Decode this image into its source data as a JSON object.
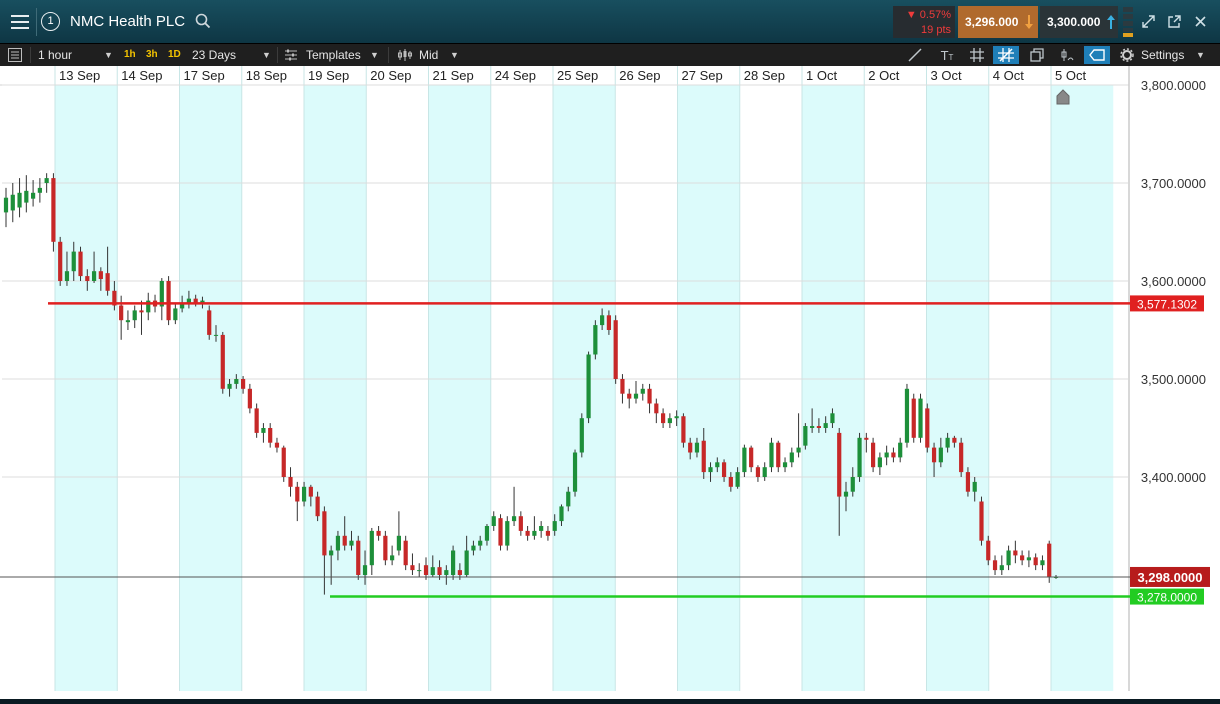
{
  "header": {
    "title": "NMC Health PLC",
    "badge": "1",
    "change_pct": "▼ 0.57%",
    "change_pts": "19 pts",
    "sell_price": "3,296.000",
    "buy_price": "3,300.000"
  },
  "toolbar": {
    "interval": "1 hour",
    "quick_1h": "1h",
    "quick_3h": "3h",
    "quick_1d": "1D",
    "range": "23 Days",
    "templates": "Templates",
    "price_mode": "Mid",
    "settings": "Settings"
  },
  "colors": {
    "up": "#1d8f3a",
    "down": "#c62828",
    "resistance": "#e02020",
    "support": "#22cc22",
    "day_band": "#dcfbfb"
  },
  "chart_data": {
    "type": "candlestick",
    "title": "NMC Health PLC",
    "x_labels": [
      "13 Sep",
      "14 Sep",
      "17 Sep",
      "18 Sep",
      "19 Sep",
      "20 Sep",
      "21 Sep",
      "24 Sep",
      "25 Sep",
      "26 Sep",
      "27 Sep",
      "28 Sep",
      "1 Oct",
      "2 Oct",
      "3 Oct",
      "4 Oct",
      "5 Oct"
    ],
    "y_ticks": [
      "3,800.0000",
      "3,700.0000",
      "3,600.0000",
      "3,500.0000",
      "3,400.0000"
    ],
    "ylim": [
      3190,
      3830
    ],
    "grid": true,
    "current_price": 3298,
    "current_price_label": "3,298.0000",
    "lines": [
      {
        "name": "resistance",
        "value": 3577.1302,
        "label": "3,577.1302",
        "start_label": "13 Sep"
      },
      {
        "name": "support",
        "value": 3278,
        "label": "3,278.0000",
        "start_label": "20 Sep"
      }
    ],
    "candles": [
      {
        "o": 3670,
        "c": 3685,
        "h": 3695,
        "l": 3655
      },
      {
        "o": 3672,
        "c": 3688,
        "h": 3700,
        "l": 3660
      },
      {
        "o": 3675,
        "c": 3690,
        "h": 3705,
        "l": 3665
      },
      {
        "o": 3680,
        "c": 3692,
        "h": 3708,
        "l": 3670
      },
      {
        "o": 3684,
        "c": 3690,
        "h": 3703,
        "l": 3676
      },
      {
        "o": 3690,
        "c": 3695,
        "h": 3705,
        "l": 3680
      },
      {
        "o": 3700,
        "c": 3705,
        "h": 3710,
        "l": 3690
      },
      {
        "o": 3705,
        "c": 3640,
        "h": 3710,
        "l": 3630
      },
      {
        "o": 3640,
        "c": 3600,
        "h": 3645,
        "l": 3595
      },
      {
        "o": 3600,
        "c": 3610,
        "h": 3630,
        "l": 3595
      },
      {
        "o": 3610,
        "c": 3630,
        "h": 3640,
        "l": 3600
      },
      {
        "o": 3630,
        "c": 3605,
        "h": 3635,
        "l": 3600
      },
      {
        "o": 3605,
        "c": 3600,
        "h": 3612,
        "l": 3590
      },
      {
        "o": 3600,
        "c": 3610,
        "h": 3630,
        "l": 3598
      },
      {
        "o": 3610,
        "c": 3602,
        "h": 3614,
        "l": 3590
      },
      {
        "o": 3608,
        "c": 3590,
        "h": 3635,
        "l": 3585
      },
      {
        "o": 3590,
        "c": 3575,
        "h": 3600,
        "l": 3570
      },
      {
        "o": 3575,
        "c": 3560,
        "h": 3585,
        "l": 3540
      },
      {
        "o": 3558,
        "c": 3560,
        "h": 3570,
        "l": 3550
      },
      {
        "o": 3560,
        "c": 3570,
        "h": 3575,
        "l": 3552
      },
      {
        "o": 3570,
        "c": 3568,
        "h": 3580,
        "l": 3545
      },
      {
        "o": 3568,
        "c": 3580,
        "h": 3588,
        "l": 3560
      },
      {
        "o": 3580,
        "c": 3574,
        "h": 3586,
        "l": 3568
      },
      {
        "o": 3574,
        "c": 3600,
        "h": 3603,
        "l": 3560
      },
      {
        "o": 3600,
        "c": 3560,
        "h": 3605,
        "l": 3555
      },
      {
        "o": 3560,
        "c": 3572,
        "h": 3578,
        "l": 3556
      },
      {
        "o": 3572,
        "c": 3578,
        "h": 3585,
        "l": 3568
      },
      {
        "o": 3578,
        "c": 3582,
        "h": 3590,
        "l": 3572
      },
      {
        "o": 3582,
        "c": 3578,
        "h": 3586,
        "l": 3574
      },
      {
        "o": 3578,
        "c": 3580,
        "h": 3584,
        "l": 3572
      },
      {
        "o": 3570,
        "c": 3545,
        "h": 3575,
        "l": 3540
      },
      {
        "o": 3545,
        "c": 3545,
        "h": 3555,
        "l": 3538
      },
      {
        "o": 3545,
        "c": 3490,
        "h": 3548,
        "l": 3485
      },
      {
        "o": 3490,
        "c": 3495,
        "h": 3500,
        "l": 3482
      },
      {
        "o": 3495,
        "c": 3500,
        "h": 3505,
        "l": 3490
      },
      {
        "o": 3500,
        "c": 3490,
        "h": 3503,
        "l": 3485
      },
      {
        "o": 3490,
        "c": 3470,
        "h": 3495,
        "l": 3465
      },
      {
        "o": 3470,
        "c": 3445,
        "h": 3475,
        "l": 3440
      },
      {
        "o": 3445,
        "c": 3450,
        "h": 3455,
        "l": 3435
      },
      {
        "o": 3450,
        "c": 3435,
        "h": 3455,
        "l": 3430
      },
      {
        "o": 3435,
        "c": 3430,
        "h": 3440,
        "l": 3425
      },
      {
        "o": 3430,
        "c": 3400,
        "h": 3432,
        "l": 3395
      },
      {
        "o": 3400,
        "c": 3390,
        "h": 3410,
        "l": 3380
      },
      {
        "o": 3390,
        "c": 3375,
        "h": 3395,
        "l": 3355
      },
      {
        "o": 3375,
        "c": 3390,
        "h": 3395,
        "l": 3370
      },
      {
        "o": 3390,
        "c": 3380,
        "h": 3392,
        "l": 3370
      },
      {
        "o": 3380,
        "c": 3360,
        "h": 3385,
        "l": 3355
      },
      {
        "o": 3365,
        "c": 3320,
        "h": 3370,
        "l": 3280
      },
      {
        "o": 3320,
        "c": 3325,
        "h": 3330,
        "l": 3290
      },
      {
        "o": 3325,
        "c": 3340,
        "h": 3345,
        "l": 3315
      },
      {
        "o": 3340,
        "c": 3330,
        "h": 3360,
        "l": 3325
      },
      {
        "o": 3330,
        "c": 3335,
        "h": 3345,
        "l": 3325
      },
      {
        "o": 3335,
        "c": 3300,
        "h": 3340,
        "l": 3295
      },
      {
        "o": 3300,
        "c": 3310,
        "h": 3325,
        "l": 3290
      },
      {
        "o": 3310,
        "c": 3345,
        "h": 3348,
        "l": 3300
      },
      {
        "o": 3345,
        "c": 3340,
        "h": 3350,
        "l": 3335
      },
      {
        "o": 3340,
        "c": 3315,
        "h": 3345,
        "l": 3310
      },
      {
        "o": 3315,
        "c": 3320,
        "h": 3330,
        "l": 3310
      },
      {
        "o": 3325,
        "c": 3340,
        "h": 3365,
        "l": 3320
      },
      {
        "o": 3335,
        "c": 3310,
        "h": 3340,
        "l": 3305
      },
      {
        "o": 3310,
        "c": 3305,
        "h": 3322,
        "l": 3300
      },
      {
        "o": 3305,
        "c": 3305,
        "h": 3312,
        "l": 3298
      },
      {
        "o": 3310,
        "c": 3300,
        "h": 3318,
        "l": 3295
      },
      {
        "o": 3300,
        "c": 3308,
        "h": 3320,
        "l": 3298
      },
      {
        "o": 3308,
        "c": 3300,
        "h": 3315,
        "l": 3295
      },
      {
        "o": 3300,
        "c": 3305,
        "h": 3310,
        "l": 3290
      },
      {
        "o": 3300,
        "c": 3325,
        "h": 3330,
        "l": 3295
      },
      {
        "o": 3305,
        "c": 3300,
        "h": 3312,
        "l": 3295
      },
      {
        "o": 3300,
        "c": 3325,
        "h": 3340,
        "l": 3298
      },
      {
        "o": 3325,
        "c": 3330,
        "h": 3335,
        "l": 3320
      },
      {
        "o": 3330,
        "c": 3335,
        "h": 3340,
        "l": 3325
      },
      {
        "o": 3335,
        "c": 3350,
        "h": 3352,
        "l": 3330
      },
      {
        "o": 3350,
        "c": 3360,
        "h": 3365,
        "l": 3345
      },
      {
        "o": 3358,
        "c": 3330,
        "h": 3362,
        "l": 3325
      },
      {
        "o": 3330,
        "c": 3355,
        "h": 3360,
        "l": 3325
      },
      {
        "o": 3355,
        "c": 3360,
        "h": 3390,
        "l": 3350
      },
      {
        "o": 3360,
        "c": 3345,
        "h": 3365,
        "l": 3340
      },
      {
        "o": 3345,
        "c": 3340,
        "h": 3350,
        "l": 3335
      },
      {
        "o": 3340,
        "c": 3345,
        "h": 3360,
        "l": 3336
      },
      {
        "o": 3345,
        "c": 3350,
        "h": 3355,
        "l": 3338
      },
      {
        "o": 3345,
        "c": 3340,
        "h": 3350,
        "l": 3335
      },
      {
        "o": 3345,
        "c": 3355,
        "h": 3362,
        "l": 3340
      },
      {
        "o": 3355,
        "c": 3370,
        "h": 3372,
        "l": 3350
      },
      {
        "o": 3370,
        "c": 3385,
        "h": 3390,
        "l": 3365
      },
      {
        "o": 3385,
        "c": 3425,
        "h": 3428,
        "l": 3380
      },
      {
        "o": 3425,
        "c": 3460,
        "h": 3465,
        "l": 3420
      },
      {
        "o": 3460,
        "c": 3525,
        "h": 3528,
        "l": 3455
      },
      {
        "o": 3525,
        "c": 3555,
        "h": 3560,
        "l": 3520
      },
      {
        "o": 3555,
        "c": 3565,
        "h": 3572,
        "l": 3550
      },
      {
        "o": 3565,
        "c": 3550,
        "h": 3570,
        "l": 3545
      },
      {
        "o": 3560,
        "c": 3500,
        "h": 3565,
        "l": 3495
      },
      {
        "o": 3500,
        "c": 3485,
        "h": 3505,
        "l": 3475
      },
      {
        "o": 3485,
        "c": 3480,
        "h": 3490,
        "l": 3470
      },
      {
        "o": 3480,
        "c": 3485,
        "h": 3498,
        "l": 3475
      },
      {
        "o": 3485,
        "c": 3490,
        "h": 3495,
        "l": 3478
      },
      {
        "o": 3490,
        "c": 3475,
        "h": 3495,
        "l": 3465
      },
      {
        "o": 3475,
        "c": 3465,
        "h": 3480,
        "l": 3455
      },
      {
        "o": 3465,
        "c": 3455,
        "h": 3470,
        "l": 3450
      },
      {
        "o": 3455,
        "c": 3460,
        "h": 3465,
        "l": 3450
      },
      {
        "o": 3460,
        "c": 3462,
        "h": 3468,
        "l": 3452
      },
      {
        "o": 3462,
        "c": 3435,
        "h": 3465,
        "l": 3430
      },
      {
        "o": 3435,
        "c": 3425,
        "h": 3440,
        "l": 3418
      },
      {
        "o": 3425,
        "c": 3435,
        "h": 3440,
        "l": 3420
      },
      {
        "o": 3437,
        "c": 3405,
        "h": 3450,
        "l": 3398
      },
      {
        "o": 3405,
        "c": 3410,
        "h": 3415,
        "l": 3395
      },
      {
        "o": 3410,
        "c": 3415,
        "h": 3420,
        "l": 3405
      },
      {
        "o": 3415,
        "c": 3400,
        "h": 3418,
        "l": 3395
      },
      {
        "o": 3400,
        "c": 3390,
        "h": 3405,
        "l": 3385
      },
      {
        "o": 3390,
        "c": 3405,
        "h": 3410,
        "l": 3388
      },
      {
        "o": 3405,
        "c": 3430,
        "h": 3433,
        "l": 3400
      },
      {
        "o": 3430,
        "c": 3410,
        "h": 3432,
        "l": 3405
      },
      {
        "o": 3410,
        "c": 3400,
        "h": 3412,
        "l": 3395
      },
      {
        "o": 3400,
        "c": 3410,
        "h": 3415,
        "l": 3396
      },
      {
        "o": 3410,
        "c": 3435,
        "h": 3440,
        "l": 3405
      },
      {
        "o": 3435,
        "c": 3410,
        "h": 3437,
        "l": 3405
      },
      {
        "o": 3410,
        "c": 3415,
        "h": 3420,
        "l": 3405
      },
      {
        "o": 3415,
        "c": 3425,
        "h": 3430,
        "l": 3410
      },
      {
        "o": 3425,
        "c": 3430,
        "h": 3465,
        "l": 3420
      },
      {
        "o": 3432,
        "c": 3452,
        "h": 3455,
        "l": 3428
      },
      {
        "o": 3450,
        "c": 3452,
        "h": 3470,
        "l": 3445
      },
      {
        "o": 3452,
        "c": 3450,
        "h": 3460,
        "l": 3445
      },
      {
        "o": 3450,
        "c": 3455,
        "h": 3462,
        "l": 3445
      },
      {
        "o": 3455,
        "c": 3465,
        "h": 3470,
        "l": 3450
      },
      {
        "o": 3445,
        "c": 3380,
        "h": 3450,
        "l": 3340
      },
      {
        "o": 3380,
        "c": 3385,
        "h": 3395,
        "l": 3365
      },
      {
        "o": 3385,
        "c": 3400,
        "h": 3410,
        "l": 3380
      },
      {
        "o": 3400,
        "c": 3440,
        "h": 3445,
        "l": 3395
      },
      {
        "o": 3440,
        "c": 3438,
        "h": 3445,
        "l": 3425
      },
      {
        "o": 3435,
        "c": 3410,
        "h": 3440,
        "l": 3405
      },
      {
        "o": 3410,
        "c": 3420,
        "h": 3425,
        "l": 3402
      },
      {
        "o": 3420,
        "c": 3425,
        "h": 3432,
        "l": 3412
      },
      {
        "o": 3425,
        "c": 3420,
        "h": 3430,
        "l": 3415
      },
      {
        "o": 3420,
        "c": 3435,
        "h": 3440,
        "l": 3415
      },
      {
        "o": 3435,
        "c": 3490,
        "h": 3495,
        "l": 3430
      },
      {
        "o": 3480,
        "c": 3440,
        "h": 3485,
        "l": 3435
      },
      {
        "o": 3440,
        "c": 3480,
        "h": 3485,
        "l": 3435
      },
      {
        "o": 3470,
        "c": 3430,
        "h": 3475,
        "l": 3425
      },
      {
        "o": 3430,
        "c": 3415,
        "h": 3435,
        "l": 3400
      },
      {
        "o": 3415,
        "c": 3430,
        "h": 3440,
        "l": 3410
      },
      {
        "o": 3430,
        "c": 3440,
        "h": 3445,
        "l": 3425
      },
      {
        "o": 3440,
        "c": 3435,
        "h": 3442,
        "l": 3430
      },
      {
        "o": 3435,
        "c": 3405,
        "h": 3440,
        "l": 3400
      },
      {
        "o": 3405,
        "c": 3385,
        "h": 3410,
        "l": 3380
      },
      {
        "o": 3385,
        "c": 3395,
        "h": 3400,
        "l": 3375
      },
      {
        "o": 3375,
        "c": 3335,
        "h": 3380,
        "l": 3330
      },
      {
        "o": 3335,
        "c": 3315,
        "h": 3340,
        "l": 3310
      },
      {
        "o": 3315,
        "c": 3305,
        "h": 3320,
        "l": 3300
      },
      {
        "o": 3305,
        "c": 3310,
        "h": 3320,
        "l": 3300
      },
      {
        "o": 3310,
        "c": 3325,
        "h": 3330,
        "l": 3305
      },
      {
        "o": 3325,
        "c": 3320,
        "h": 3335,
        "l": 3312
      },
      {
        "o": 3320,
        "c": 3315,
        "h": 3325,
        "l": 3310
      },
      {
        "o": 3315,
        "c": 3318,
        "h": 3325,
        "l": 3308
      },
      {
        "o": 3318,
        "c": 3310,
        "h": 3322,
        "l": 3305
      },
      {
        "o": 3310,
        "c": 3315,
        "h": 3320,
        "l": 3305
      },
      {
        "o": 3332,
        "c": 3298,
        "h": 3335,
        "l": 3292
      },
      {
        "o": 3298,
        "c": 3298,
        "h": 3300,
        "l": 3296
      }
    ]
  }
}
